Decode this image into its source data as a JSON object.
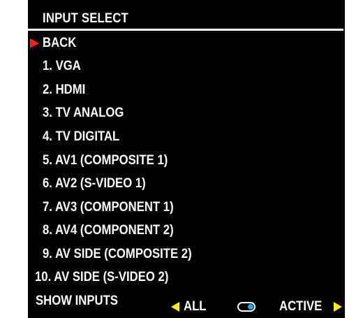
{
  "menu": {
    "title": "INPUT SELECT",
    "selected_index": 0,
    "items": [
      {
        "label": "BACK"
      },
      {
        "label": "1. VGA"
      },
      {
        "label": "2. HDMI"
      },
      {
        "label": "3. TV ANALOG"
      },
      {
        "label": "4. TV DIGITAL"
      },
      {
        "label": "5. AV1 (COMPOSITE 1)"
      },
      {
        "label": "6. AV2 (S-VIDEO 1)"
      },
      {
        "label": "7. AV3 (COMPONENT 1)"
      },
      {
        "label": "8. AV4 (COMPONENT 2)"
      },
      {
        "label": "9. AV SIDE (COMPOSITE 2)"
      },
      {
        "label": "10. AV SIDE (S-VIDEO 2)"
      }
    ]
  },
  "footer": {
    "label": "SHOW INPUTS",
    "option_left": "ALL",
    "option_right": "ACTIVE",
    "selected_option": "ACTIVE"
  },
  "colors": {
    "background": "#000000",
    "text": "#ffffff",
    "cursor": "#ff1e1e",
    "arrows": "#ffee00",
    "toggle_knob": "#2fa6e6"
  },
  "icons": {
    "cursor": "red-triangle-pointer-icon",
    "left_arrow": "yellow-left-triangle-icon",
    "right_arrow": "yellow-right-triangle-icon",
    "toggle": "toggle-switch-icon"
  }
}
